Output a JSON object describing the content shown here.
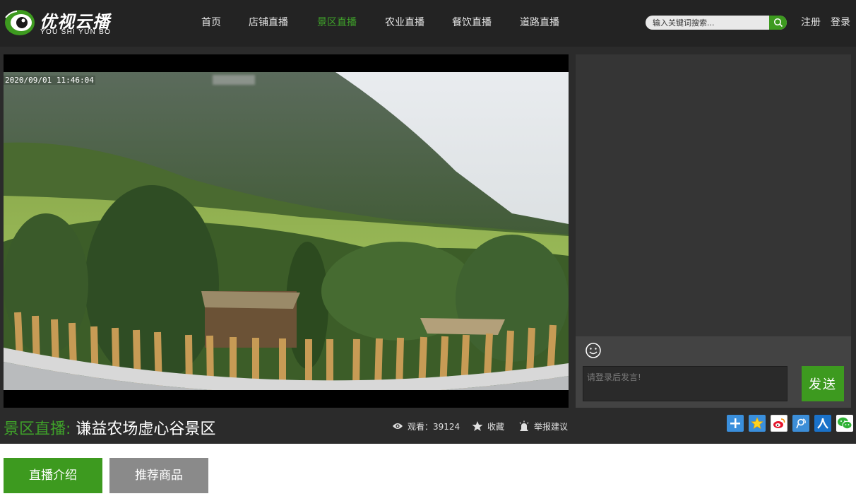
{
  "brand": {
    "name_cn": "优视云播",
    "name_en": "YOU SHI YUN BO"
  },
  "nav": [
    {
      "label": "首页",
      "active": false
    },
    {
      "label": "店铺直播",
      "active": false
    },
    {
      "label": "景区直播",
      "active": true
    },
    {
      "label": "农业直播",
      "active": false
    },
    {
      "label": "餐饮直播",
      "active": false
    },
    {
      "label": "道路直播",
      "active": false
    }
  ],
  "search": {
    "placeholder": "输入关键词搜索...",
    "icon": "search-icon"
  },
  "auth": {
    "register": "注册",
    "login": "登录"
  },
  "player": {
    "timestamp": "2020/09/01 11:46:04"
  },
  "chat": {
    "emoji_icon": "smiley-icon",
    "input_placeholder": "请登录后发言!",
    "send_label": "发送"
  },
  "stream": {
    "category": "景区直播:",
    "name": "谦益农场虚心谷景区",
    "viewers_label": "观看：39124",
    "favorite_label": "收藏",
    "report_label": "举报建议"
  },
  "share": [
    "share-more-icon",
    "qzone-icon",
    "weibo-icon",
    "tencent-weibo-icon",
    "renren-icon",
    "wechat-icon"
  ],
  "tabs": [
    {
      "label": "直播介绍",
      "active": true
    },
    {
      "label": "推荐商品",
      "active": false
    }
  ],
  "colors": {
    "accent": "#3d9a1f",
    "header_bg": "#232323",
    "main_bg": "#2b2b2b"
  }
}
